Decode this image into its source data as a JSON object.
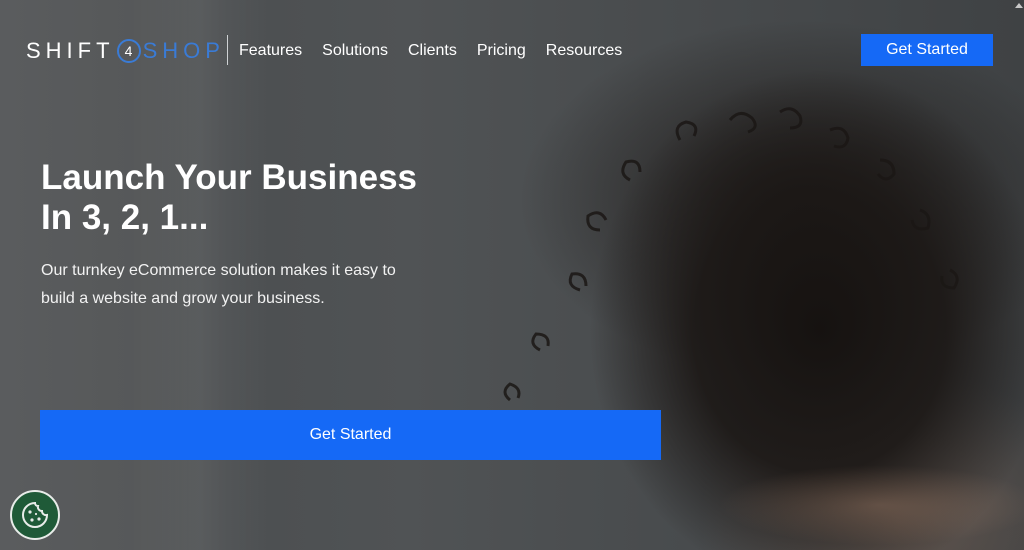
{
  "brand": {
    "part1": "SHIFT",
    "part2": "4",
    "part3": "SHOP",
    "accent_color": "#1569f6"
  },
  "nav": {
    "items": [
      "Features",
      "Solutions",
      "Clients",
      "Pricing",
      "Resources"
    ]
  },
  "header": {
    "cta_label": "Get Started"
  },
  "hero": {
    "headline_line1": "Launch Your Business",
    "headline_line2": "In 3, 2, 1...",
    "subtext": "Our turnkey eCommerce solution makes it easy to build a website and grow your business.",
    "cta_label": "Get Started"
  },
  "icons": {
    "cookie": "cookie-icon",
    "scroll_up": "chevron-up-icon"
  }
}
